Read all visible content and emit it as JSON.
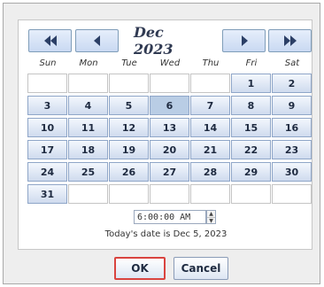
{
  "header": {
    "month_year": "Dec 2023",
    "nav_icons": [
      "double-left-arrow",
      "left-arrow",
      "right-arrow",
      "double-right-arrow"
    ]
  },
  "weekdays": [
    "Sun",
    "Mon",
    "Tue",
    "Wed",
    "Thu",
    "Fri",
    "Sat"
  ],
  "weeks": [
    [
      "",
      "",
      "",
      "",
      "",
      "1",
      "2"
    ],
    [
      "3",
      "4",
      "5",
      "6",
      "7",
      "8",
      "9"
    ],
    [
      "10",
      "11",
      "12",
      "13",
      "14",
      "15",
      "16"
    ],
    [
      "17",
      "18",
      "19",
      "20",
      "21",
      "22",
      "23"
    ],
    [
      "24",
      "25",
      "26",
      "27",
      "28",
      "29",
      "30"
    ],
    [
      "31",
      "",
      "",
      "",
      "",
      "",
      ""
    ]
  ],
  "selected_day": "6",
  "time_value": "6:00:00 AM",
  "today_text": "Today's date is Dec 5, 2023",
  "buttons": {
    "ok": "OK",
    "cancel": "Cancel"
  },
  "colors": {
    "ok_highlight": "#d9443f",
    "selected_day": "#b9cde5"
  }
}
